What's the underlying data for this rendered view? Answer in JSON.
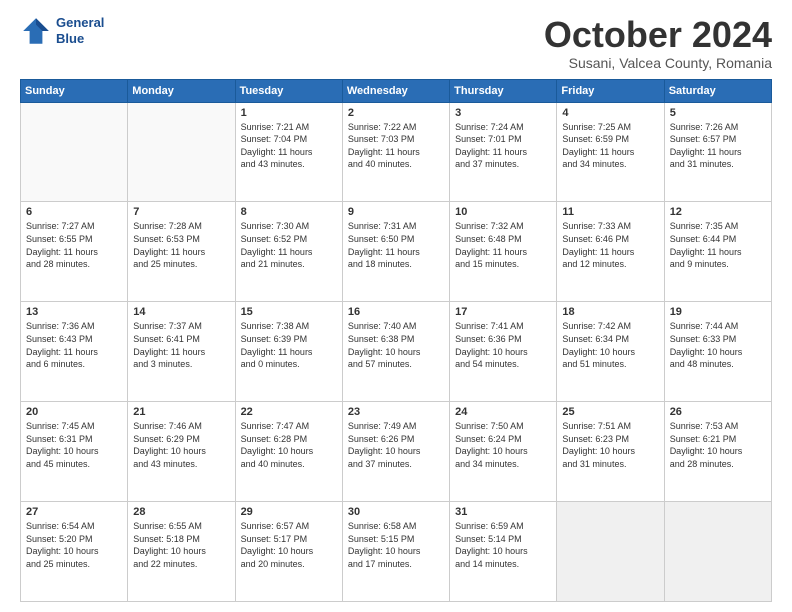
{
  "header": {
    "logo_line1": "General",
    "logo_line2": "Blue",
    "month": "October 2024",
    "location": "Susani, Valcea County, Romania"
  },
  "weekdays": [
    "Sunday",
    "Monday",
    "Tuesday",
    "Wednesday",
    "Thursday",
    "Friday",
    "Saturday"
  ],
  "weeks": [
    [
      {
        "day": "",
        "info": ""
      },
      {
        "day": "",
        "info": ""
      },
      {
        "day": "1",
        "info": "Sunrise: 7:21 AM\nSunset: 7:04 PM\nDaylight: 11 hours\nand 43 minutes."
      },
      {
        "day": "2",
        "info": "Sunrise: 7:22 AM\nSunset: 7:03 PM\nDaylight: 11 hours\nand 40 minutes."
      },
      {
        "day": "3",
        "info": "Sunrise: 7:24 AM\nSunset: 7:01 PM\nDaylight: 11 hours\nand 37 minutes."
      },
      {
        "day": "4",
        "info": "Sunrise: 7:25 AM\nSunset: 6:59 PM\nDaylight: 11 hours\nand 34 minutes."
      },
      {
        "day": "5",
        "info": "Sunrise: 7:26 AM\nSunset: 6:57 PM\nDaylight: 11 hours\nand 31 minutes."
      }
    ],
    [
      {
        "day": "6",
        "info": "Sunrise: 7:27 AM\nSunset: 6:55 PM\nDaylight: 11 hours\nand 28 minutes."
      },
      {
        "day": "7",
        "info": "Sunrise: 7:28 AM\nSunset: 6:53 PM\nDaylight: 11 hours\nand 25 minutes."
      },
      {
        "day": "8",
        "info": "Sunrise: 7:30 AM\nSunset: 6:52 PM\nDaylight: 11 hours\nand 21 minutes."
      },
      {
        "day": "9",
        "info": "Sunrise: 7:31 AM\nSunset: 6:50 PM\nDaylight: 11 hours\nand 18 minutes."
      },
      {
        "day": "10",
        "info": "Sunrise: 7:32 AM\nSunset: 6:48 PM\nDaylight: 11 hours\nand 15 minutes."
      },
      {
        "day": "11",
        "info": "Sunrise: 7:33 AM\nSunset: 6:46 PM\nDaylight: 11 hours\nand 12 minutes."
      },
      {
        "day": "12",
        "info": "Sunrise: 7:35 AM\nSunset: 6:44 PM\nDaylight: 11 hours\nand 9 minutes."
      }
    ],
    [
      {
        "day": "13",
        "info": "Sunrise: 7:36 AM\nSunset: 6:43 PM\nDaylight: 11 hours\nand 6 minutes."
      },
      {
        "day": "14",
        "info": "Sunrise: 7:37 AM\nSunset: 6:41 PM\nDaylight: 11 hours\nand 3 minutes."
      },
      {
        "day": "15",
        "info": "Sunrise: 7:38 AM\nSunset: 6:39 PM\nDaylight: 11 hours\nand 0 minutes."
      },
      {
        "day": "16",
        "info": "Sunrise: 7:40 AM\nSunset: 6:38 PM\nDaylight: 10 hours\nand 57 minutes."
      },
      {
        "day": "17",
        "info": "Sunrise: 7:41 AM\nSunset: 6:36 PM\nDaylight: 10 hours\nand 54 minutes."
      },
      {
        "day": "18",
        "info": "Sunrise: 7:42 AM\nSunset: 6:34 PM\nDaylight: 10 hours\nand 51 minutes."
      },
      {
        "day": "19",
        "info": "Sunrise: 7:44 AM\nSunset: 6:33 PM\nDaylight: 10 hours\nand 48 minutes."
      }
    ],
    [
      {
        "day": "20",
        "info": "Sunrise: 7:45 AM\nSunset: 6:31 PM\nDaylight: 10 hours\nand 45 minutes."
      },
      {
        "day": "21",
        "info": "Sunrise: 7:46 AM\nSunset: 6:29 PM\nDaylight: 10 hours\nand 43 minutes."
      },
      {
        "day": "22",
        "info": "Sunrise: 7:47 AM\nSunset: 6:28 PM\nDaylight: 10 hours\nand 40 minutes."
      },
      {
        "day": "23",
        "info": "Sunrise: 7:49 AM\nSunset: 6:26 PM\nDaylight: 10 hours\nand 37 minutes."
      },
      {
        "day": "24",
        "info": "Sunrise: 7:50 AM\nSunset: 6:24 PM\nDaylight: 10 hours\nand 34 minutes."
      },
      {
        "day": "25",
        "info": "Sunrise: 7:51 AM\nSunset: 6:23 PM\nDaylight: 10 hours\nand 31 minutes."
      },
      {
        "day": "26",
        "info": "Sunrise: 7:53 AM\nSunset: 6:21 PM\nDaylight: 10 hours\nand 28 minutes."
      }
    ],
    [
      {
        "day": "27",
        "info": "Sunrise: 6:54 AM\nSunset: 5:20 PM\nDaylight: 10 hours\nand 25 minutes."
      },
      {
        "day": "28",
        "info": "Sunrise: 6:55 AM\nSunset: 5:18 PM\nDaylight: 10 hours\nand 22 minutes."
      },
      {
        "day": "29",
        "info": "Sunrise: 6:57 AM\nSunset: 5:17 PM\nDaylight: 10 hours\nand 20 minutes."
      },
      {
        "day": "30",
        "info": "Sunrise: 6:58 AM\nSunset: 5:15 PM\nDaylight: 10 hours\nand 17 minutes."
      },
      {
        "day": "31",
        "info": "Sunrise: 6:59 AM\nSunset: 5:14 PM\nDaylight: 10 hours\nand 14 minutes."
      },
      {
        "day": "",
        "info": ""
      },
      {
        "day": "",
        "info": ""
      }
    ]
  ]
}
